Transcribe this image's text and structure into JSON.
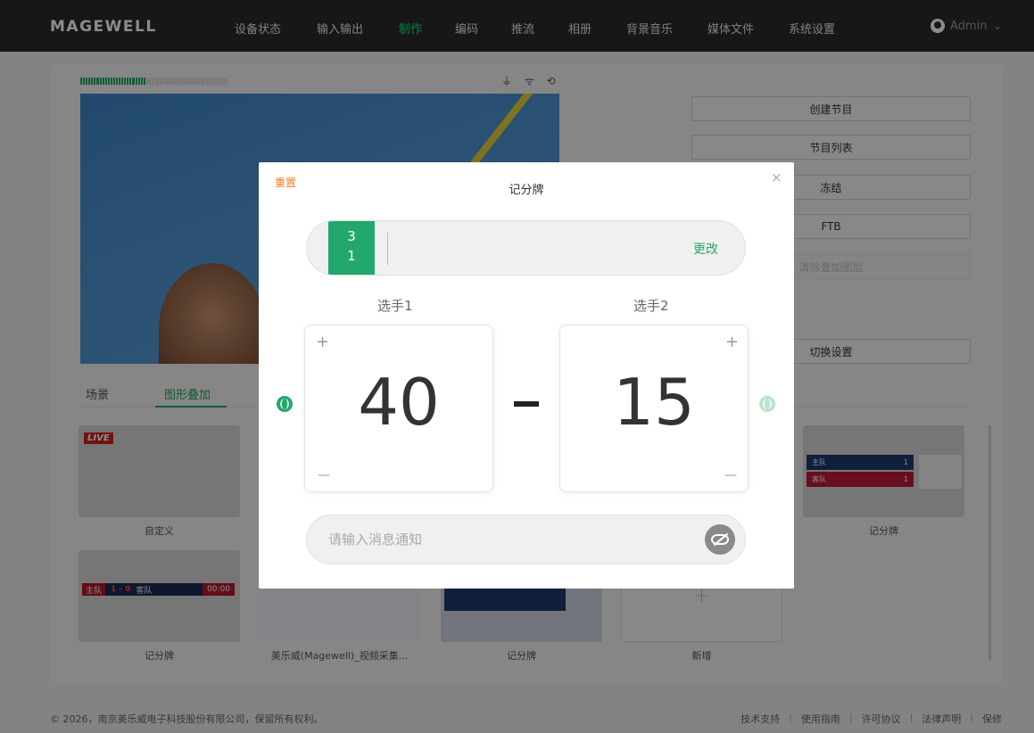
{
  "brand": "MAGEWELL",
  "nav": [
    "设备状态",
    "输入输出",
    "制作",
    "编码",
    "推流",
    "相册",
    "背景音乐",
    "媒体文件",
    "系统设置"
  ],
  "nav_active": "制作",
  "user": "Admin",
  "status_icons": "⏚ ᯤ ⟲",
  "side_buttons": [
    "创建节目",
    "节目列表",
    "冻结",
    "FTB",
    "清除叠加图层",
    "切换设置"
  ],
  "tabs": [
    "场景",
    "图形叠加"
  ],
  "thumbs": {
    "live_badge": "LIVE",
    "labels": [
      "自定义",
      "记分牌",
      "记分牌",
      "美乐威(Magewell)_视频采集...",
      "记分牌",
      "新增"
    ],
    "scoreboard": {
      "home": "主队",
      "score": "1 - 0",
      "away": "客队",
      "time": "00:00"
    },
    "tennis": {
      "home": "主队",
      "home_score": "1",
      "away": "客队",
      "away_score": "1"
    }
  },
  "footer": {
    "copyright": "© 2026，南京美乐威电子科技股份有限公司，保留所有权利。",
    "links": [
      "技术支持",
      "使用指南",
      "许可协议",
      "法律声明",
      "保修"
    ]
  },
  "modal": {
    "reset": "重置",
    "title": "记分牌",
    "close": "×",
    "set_top": "3",
    "set_bottom": "1",
    "change": "更改",
    "player1": "选手1",
    "player2": "选手2",
    "score1": "40",
    "score2": "15",
    "plus": "+",
    "minus": "—",
    "message_placeholder": "请输入消息通知",
    "message_value": ""
  },
  "colors": {
    "accent": "#22a86d",
    "reset": "#f07c19",
    "nav_bg": "#2b2b2b"
  }
}
